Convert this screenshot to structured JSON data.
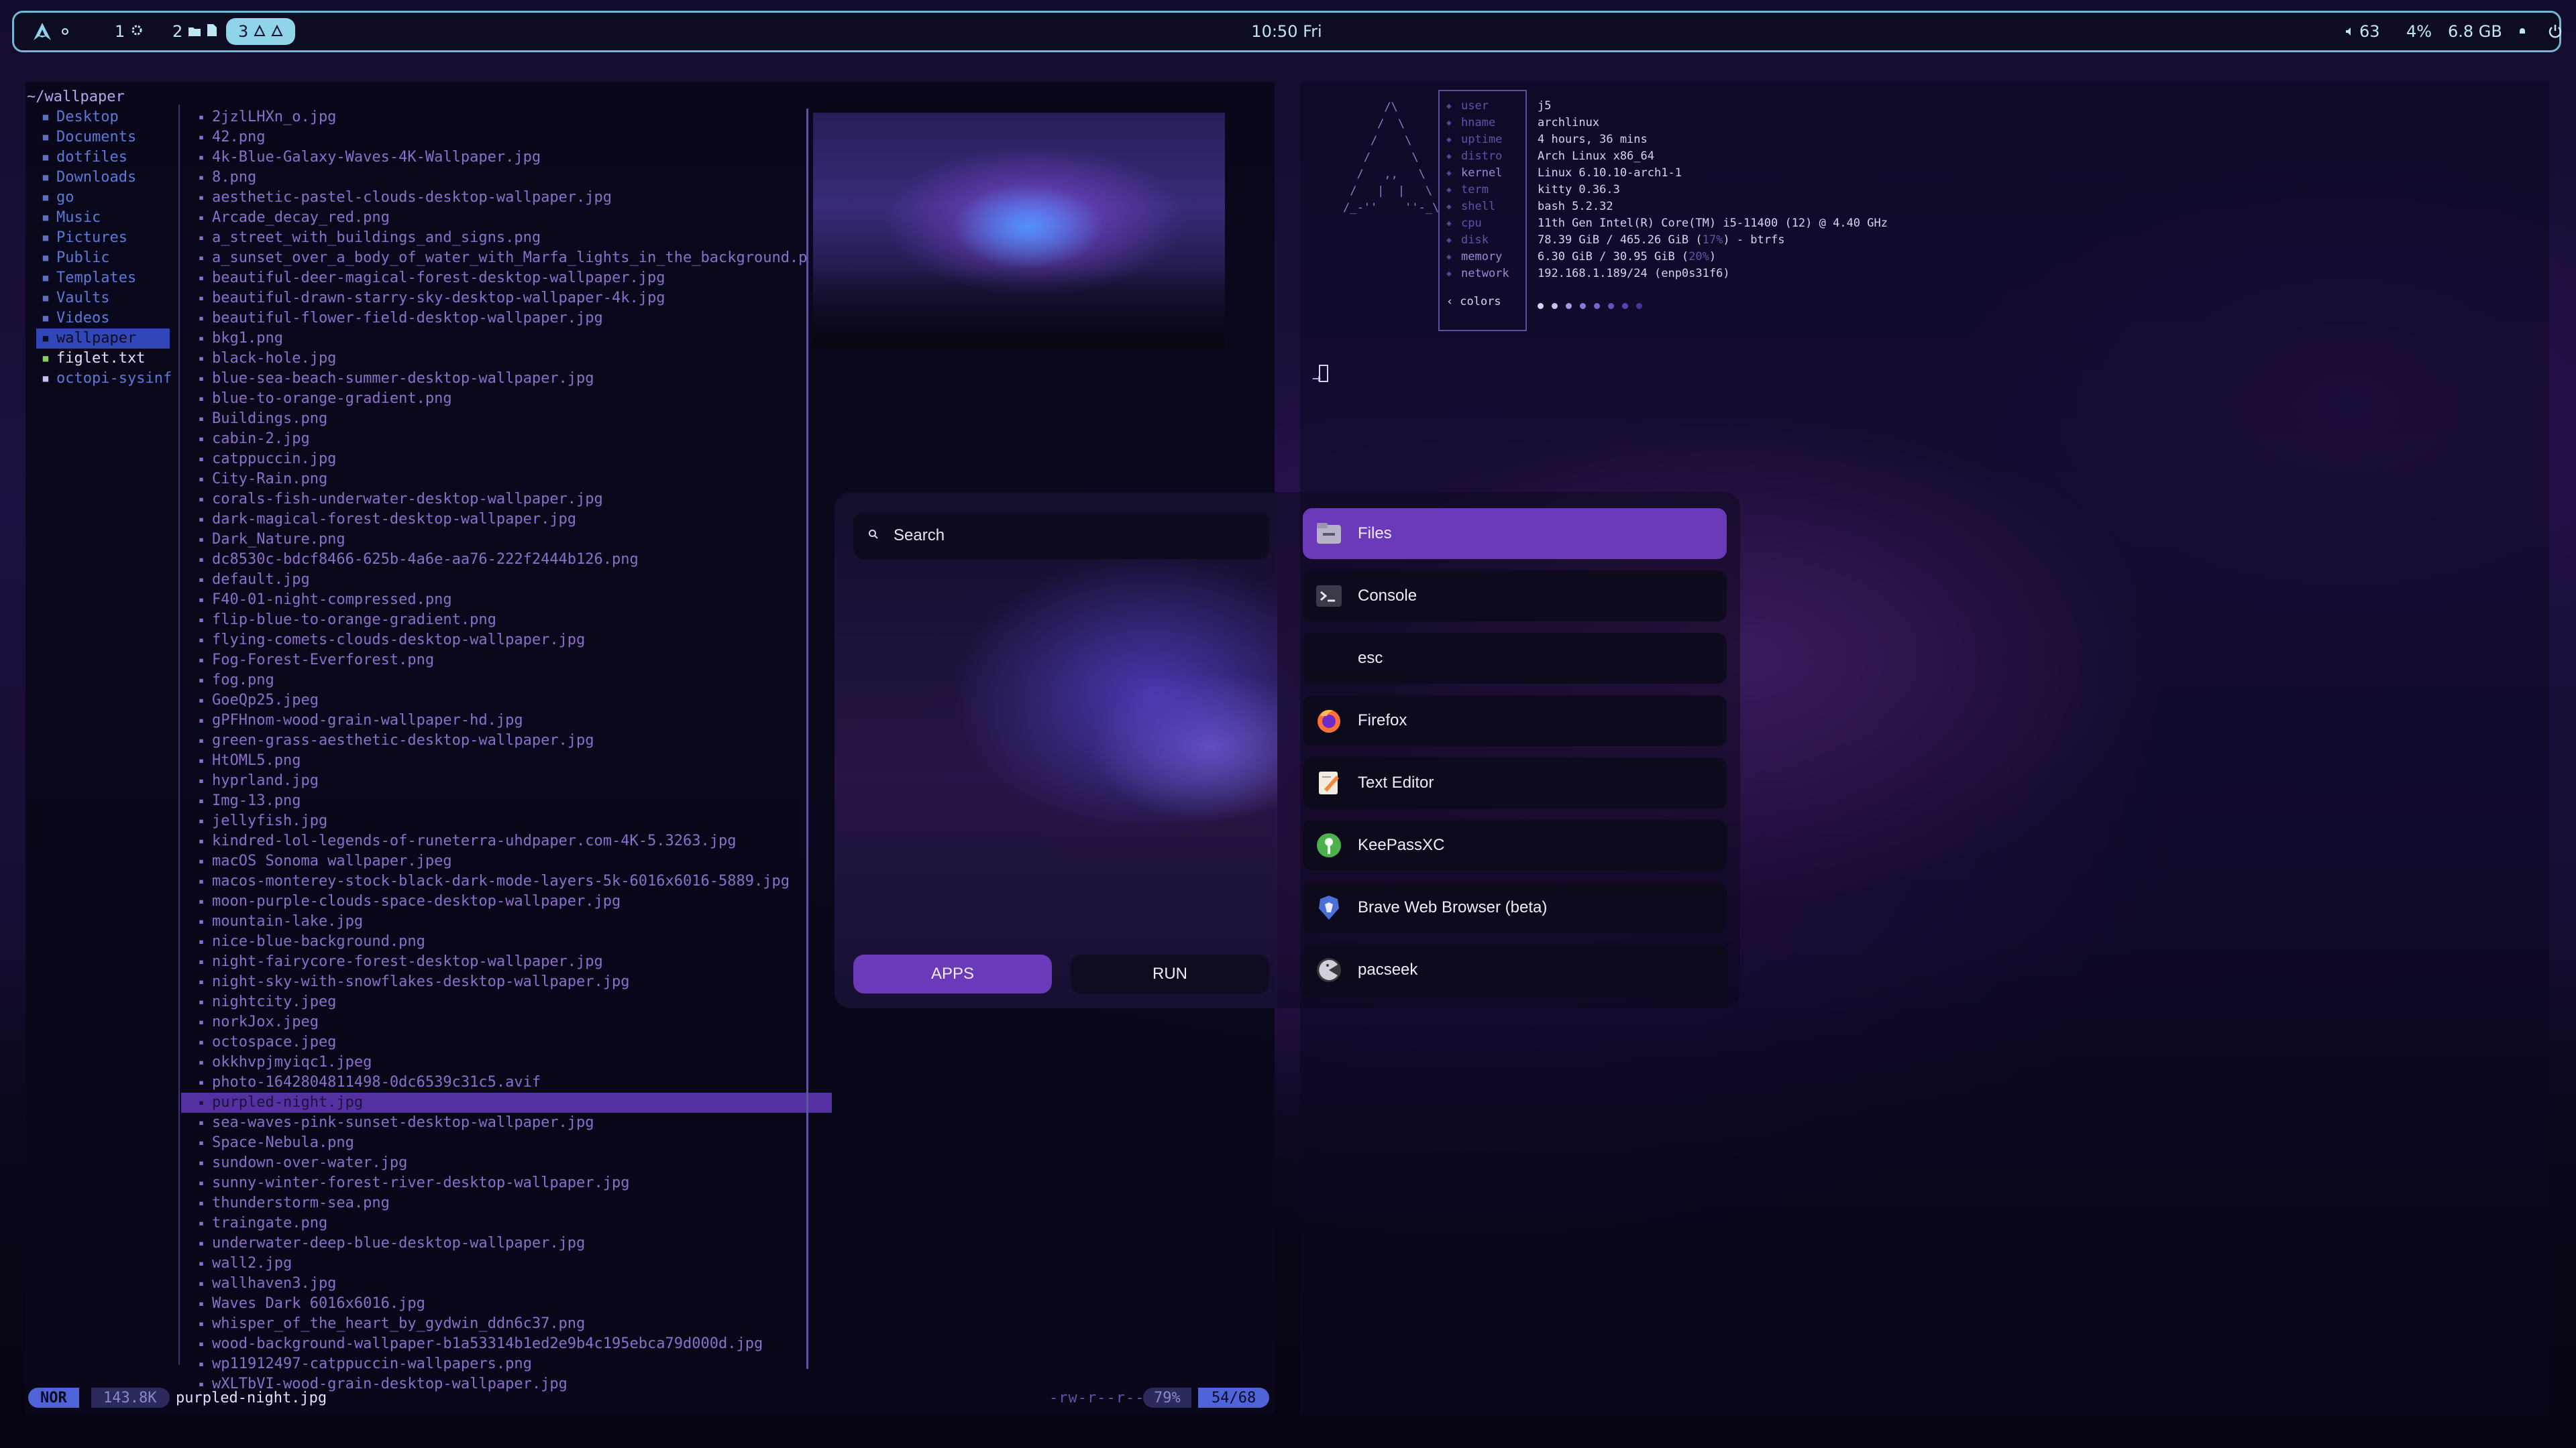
{
  "topbar": {
    "workspaces": [
      {
        "id": "1",
        "icon": "settings-icon"
      },
      {
        "id": "2",
        "icons": [
          "folder-icon",
          "file-icon"
        ]
      },
      {
        "id": "3",
        "icons": [
          "triangle-icon",
          "triangle-icon"
        ],
        "active": true
      }
    ],
    "clock": "10:50  Fri",
    "volume": "63",
    "cpu": "4%",
    "memory": "6.8 GB",
    "accent_color": "#6fb9d6"
  },
  "file_manager": {
    "path": "~/wallpaper",
    "dirs": [
      "Desktop",
      "Documents",
      "dotfiles",
      "Downloads",
      "go",
      "Music",
      "Pictures",
      "Public",
      "Templates",
      "Vaults",
      "Videos",
      "wallpaper"
    ],
    "files": [
      "figlet.txt",
      "octopi-sysinf"
    ],
    "entries": [
      "2jzlLHXn_o.jpg",
      "42.png",
      "4k-Blue-Galaxy-Waves-4K-Wallpaper.jpg",
      "8.png",
      "aesthetic-pastel-clouds-desktop-wallpaper.jpg",
      "Arcade_decay_red.png",
      "a_street_with_buildings_and_signs.png",
      "a_sunset_over_a_body_of_water_with_Marfa_lights_in_the_background.p",
      "beautiful-deer-magical-forest-desktop-wallpaper.jpg",
      "beautiful-drawn-starry-sky-desktop-wallpaper-4k.jpg",
      "beautiful-flower-field-desktop-wallpaper.jpg",
      "bkg1.png",
      "black-hole.jpg",
      "blue-sea-beach-summer-desktop-wallpaper.jpg",
      "blue-to-orange-gradient.png",
      "Buildings.png",
      "cabin-2.jpg",
      "catppuccin.jpg",
      "City-Rain.png",
      "corals-fish-underwater-desktop-wallpaper.jpg",
      "dark-magical-forest-desktop-wallpaper.jpg",
      "Dark_Nature.png",
      "dc8530c-bdcf8466-625b-4a6e-aa76-222f2444b126.png",
      "default.jpg",
      "F40-01-night-compressed.png",
      "flip-blue-to-orange-gradient.png",
      "flying-comets-clouds-desktop-wallpaper.jpg",
      "Fog-Forest-Everforest.png",
      "fog.png",
      "GoeQp25.jpeg",
      "gPFHnom-wood-grain-wallpaper-hd.jpg",
      "green-grass-aesthetic-desktop-wallpaper.jpg",
      "HtOML5.png",
      "hyprland.jpg",
      "Img-13.png",
      "jellyfish.jpg",
      "kindred-lol-legends-of-runeterra-uhdpaper.com-4K-5.3263.jpg",
      "macOS Sonoma wallpaper.jpeg",
      "macos-monterey-stock-black-dark-mode-layers-5k-6016x6016-5889.jpg",
      "moon-purple-clouds-space-desktop-wallpaper.jpg",
      "mountain-lake.jpg",
      "nice-blue-background.png",
      "night-fairycore-forest-desktop-wallpaper.jpg",
      "night-sky-with-snowflakes-desktop-wallpaper.jpg",
      "nightcity.jpeg",
      "norkJox.jpeg",
      "octospace.jpeg",
      "okkhvpjmyiqc1.jpeg",
      "photo-1642804811498-0dc6539c31c5.avif",
      "purpled-night.jpg",
      "sea-waves-pink-sunset-desktop-wallpaper.jpg",
      "Space-Nebula.png",
      "sundown-over-water.jpg",
      "sunny-winter-forest-river-desktop-wallpaper.jpg",
      "thunderstorm-sea.png",
      "traingate.png",
      "underwater-deep-blue-desktop-wallpaper.jpg",
      "wall2.jpg",
      "wallhaven3.jpg",
      "Waves Dark 6016x6016.jpg",
      "whisper_of_the_heart_by_gydwin_ddn6c37.png",
      "wood-background-wallpaper-b1a53314b1ed2e9b4c195ebca79d000d.jpg",
      "wp11912497-catppuccin-wallpapers.png",
      "wXLTbVI-wood-grain-desktop-wallpaper.jpg"
    ],
    "selected_index": 49,
    "status": {
      "mode": "NOR",
      "size": "143.8K",
      "filename": "purpled-night.jpg",
      "permissions": "-rw-r--r--",
      "percent": "79%",
      "position": "54/68"
    }
  },
  "fastfetch": {
    "logo": "      /\\\n     /  \\\n    /    \\\n   /      \\\n  /   ,,   \\\n /   |  |   \\\n/_-''    ''-_\\",
    "keys": [
      "user",
      "hname",
      "uptime",
      "distro",
      "kernel",
      "term",
      "shell",
      "cpu",
      "disk",
      "memory",
      "network"
    ],
    "values": {
      "user": "j5",
      "hname": "archlinux",
      "uptime": "4 hours, 36 mins",
      "distro": "Arch Linux x86_64",
      "kernel": "Linux 6.10.10-arch1-1",
      "term": "kitty 0.36.3",
      "shell": "bash 5.2.32",
      "cpu": "11th Gen Intel(R) Core(TM) i5-11400 (12) @ 4.40 GHz",
      "disk_used": "78.39 GiB / 465.26 GiB (",
      "disk_pct": "17%",
      "disk_fs": ") - btrfs",
      "memory_used": "6.30 GiB / 30.95 GiB (",
      "memory_pct": "20%",
      "memory_close": ")",
      "network": "192.168.1.189/24 (enp0s31f6)"
    },
    "colors_label": "colors",
    "swatches": [
      "#d8d2f2",
      "#c9bff0",
      "#a895e6",
      "#8c78dc",
      "#7a62d0",
      "#6a4fc4",
      "#5b40b4",
      "#4c34a0"
    ],
    "prompt": "→"
  },
  "launcher": {
    "search_placeholder": "Search",
    "tabs": {
      "apps": "APPS",
      "run": "RUN"
    },
    "apps": [
      {
        "name": "Files",
        "icon": "files-icon",
        "active": true
      },
      {
        "name": "Console",
        "icon": "console-icon"
      },
      {
        "name": "esc",
        "icon": ""
      },
      {
        "name": "Firefox",
        "icon": "firefox-icon"
      },
      {
        "name": "Text Editor",
        "icon": "text-editor-icon"
      },
      {
        "name": "KeePassXC",
        "icon": "keepassxc-icon"
      },
      {
        "name": "Brave Web Browser (beta)",
        "icon": "brave-icon"
      },
      {
        "name": "pacseek",
        "icon": "pacseek-icon"
      }
    ]
  }
}
